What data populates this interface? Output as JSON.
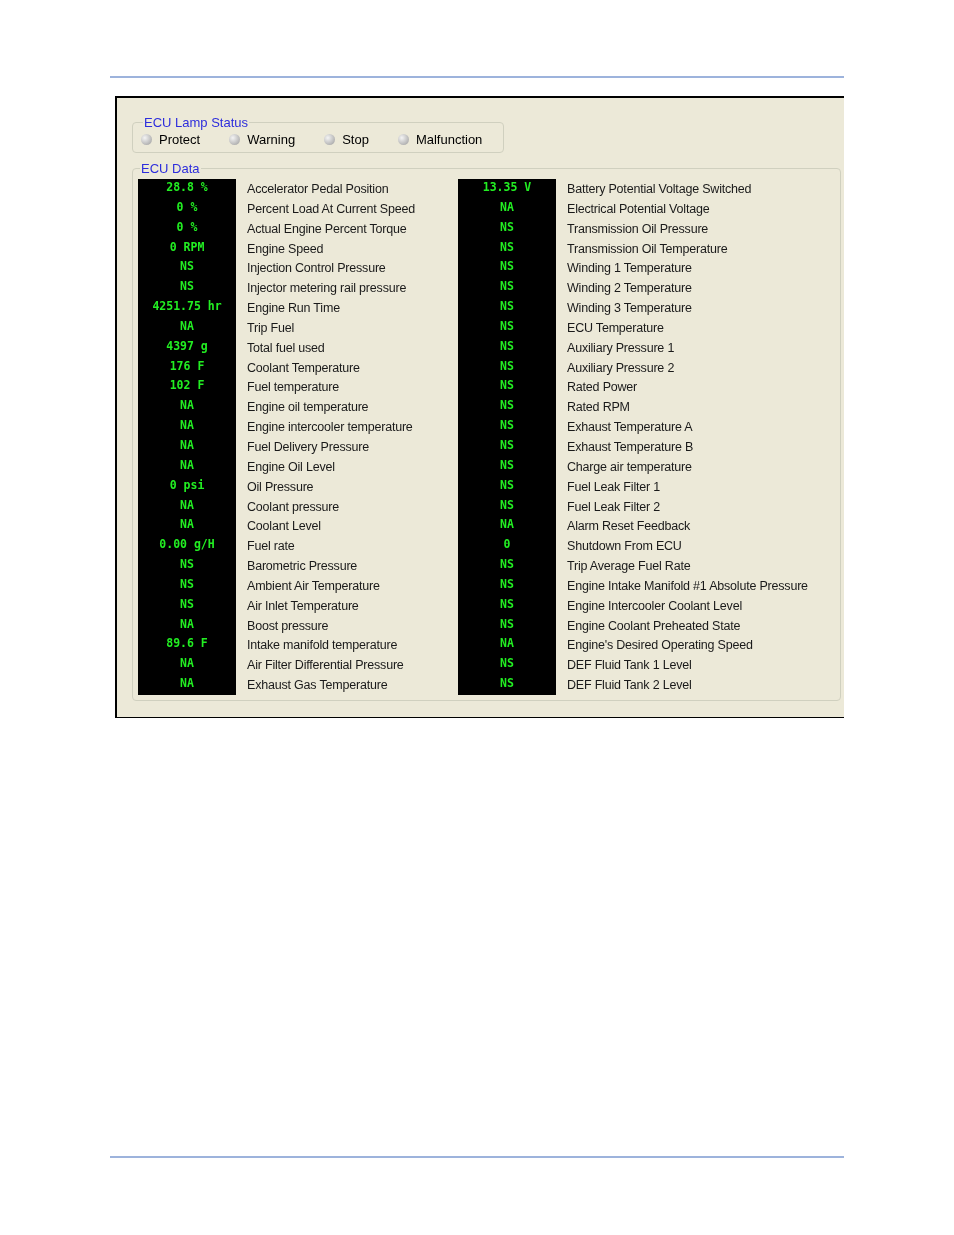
{
  "lamp_status": {
    "title": "ECU Lamp Status",
    "lamps": [
      {
        "label": "Protect",
        "on": false
      },
      {
        "label": "Warning",
        "on": false
      },
      {
        "label": "Stop",
        "on": false
      },
      {
        "label": "Malfunction",
        "on": false
      }
    ]
  },
  "ecu_data": {
    "title": "ECU Data",
    "columns": [
      [
        {
          "value": "28.8 %",
          "label": "Accelerator Pedal Position"
        },
        {
          "value": "0 %",
          "label": "Percent Load At Current Speed"
        },
        {
          "value": "0 %",
          "label": "Actual Engine Percent Torque"
        },
        {
          "value": "0 RPM",
          "label": "Engine Speed"
        },
        {
          "value": "NS",
          "label": "Injection Control Pressure"
        },
        {
          "value": "NS",
          "label": "Injector metering rail pressure"
        },
        {
          "value": "4251.75 hr",
          "label": "Engine Run Time"
        },
        {
          "value": "NA",
          "label": "Trip Fuel"
        },
        {
          "value": "4397 g",
          "label": "Total fuel used"
        },
        {
          "value": "176 F",
          "label": "Coolant Temperature"
        },
        {
          "value": "102 F",
          "label": "Fuel temperature"
        },
        {
          "value": "NA",
          "label": "Engine oil temperature"
        },
        {
          "value": "NA",
          "label": "Engine intercooler temperature"
        },
        {
          "value": "NA",
          "label": "Fuel Delivery Pressure"
        },
        {
          "value": "NA",
          "label": "Engine Oil Level"
        },
        {
          "value": "0 psi",
          "label": "Oil Pressure"
        },
        {
          "value": "NA",
          "label": "Coolant pressure"
        },
        {
          "value": "NA",
          "label": "Coolant Level"
        },
        {
          "value": "0.00 g/H",
          "label": "Fuel rate"
        },
        {
          "value": "NS",
          "label": "Barometric Pressure"
        },
        {
          "value": "NS",
          "label": "Ambient Air Temperature"
        },
        {
          "value": "NS",
          "label": "Air Inlet Temperature"
        },
        {
          "value": "NA",
          "label": "Boost pressure"
        },
        {
          "value": "89.6 F",
          "label": "Intake manifold temperature"
        },
        {
          "value": "NA",
          "label": "Air Filter Differential Pressure"
        },
        {
          "value": "NA",
          "label": "Exhaust Gas Temperature"
        }
      ],
      [
        {
          "value": "13.35 V",
          "label": "Battery Potential Voltage Switched"
        },
        {
          "value": "NA",
          "label": "Electrical Potential Voltage"
        },
        {
          "value": "NS",
          "label": "Transmission Oil Pressure"
        },
        {
          "value": "NS",
          "label": "Transmission Oil Temperature"
        },
        {
          "value": "NS",
          "label": "Winding 1 Temperature"
        },
        {
          "value": "NS",
          "label": "Winding 2 Temperature"
        },
        {
          "value": "NS",
          "label": "Winding 3 Temperature"
        },
        {
          "value": "NS",
          "label": "ECU Temperature"
        },
        {
          "value": "NS",
          "label": "Auxiliary Pressure 1"
        },
        {
          "value": "NS",
          "label": "Auxiliary Pressure 2"
        },
        {
          "value": "NS",
          "label": "Rated Power"
        },
        {
          "value": "NS",
          "label": "Rated RPM"
        },
        {
          "value": "NS",
          "label": "Exhaust Temperature A"
        },
        {
          "value": "NS",
          "label": "Exhaust Temperature B"
        },
        {
          "value": "NS",
          "label": "Charge air temperature"
        },
        {
          "value": "NS",
          "label": "Fuel Leak Filter 1"
        },
        {
          "value": "NS",
          "label": "Fuel Leak Filter 2"
        },
        {
          "value": "NA",
          "label": "Alarm Reset Feedback"
        },
        {
          "value": "0",
          "label": "Shutdown From ECU"
        },
        {
          "value": "NS",
          "label": "Trip Average Fuel Rate"
        },
        {
          "value": "NS",
          "label": "Engine Intake Manifold #1 Absolute Pressure"
        },
        {
          "value": "NS",
          "label": "Engine Intercooler Coolant Level"
        },
        {
          "value": "NS",
          "label": "Engine Coolant Preheated State"
        },
        {
          "value": "NA",
          "label": "Engine's Desired Operating Speed"
        },
        {
          "value": "NS",
          "label": "DEF Fluid Tank 1 Level"
        },
        {
          "value": "NS",
          "label": "DEF Fluid Tank 2 Level"
        }
      ]
    ]
  }
}
